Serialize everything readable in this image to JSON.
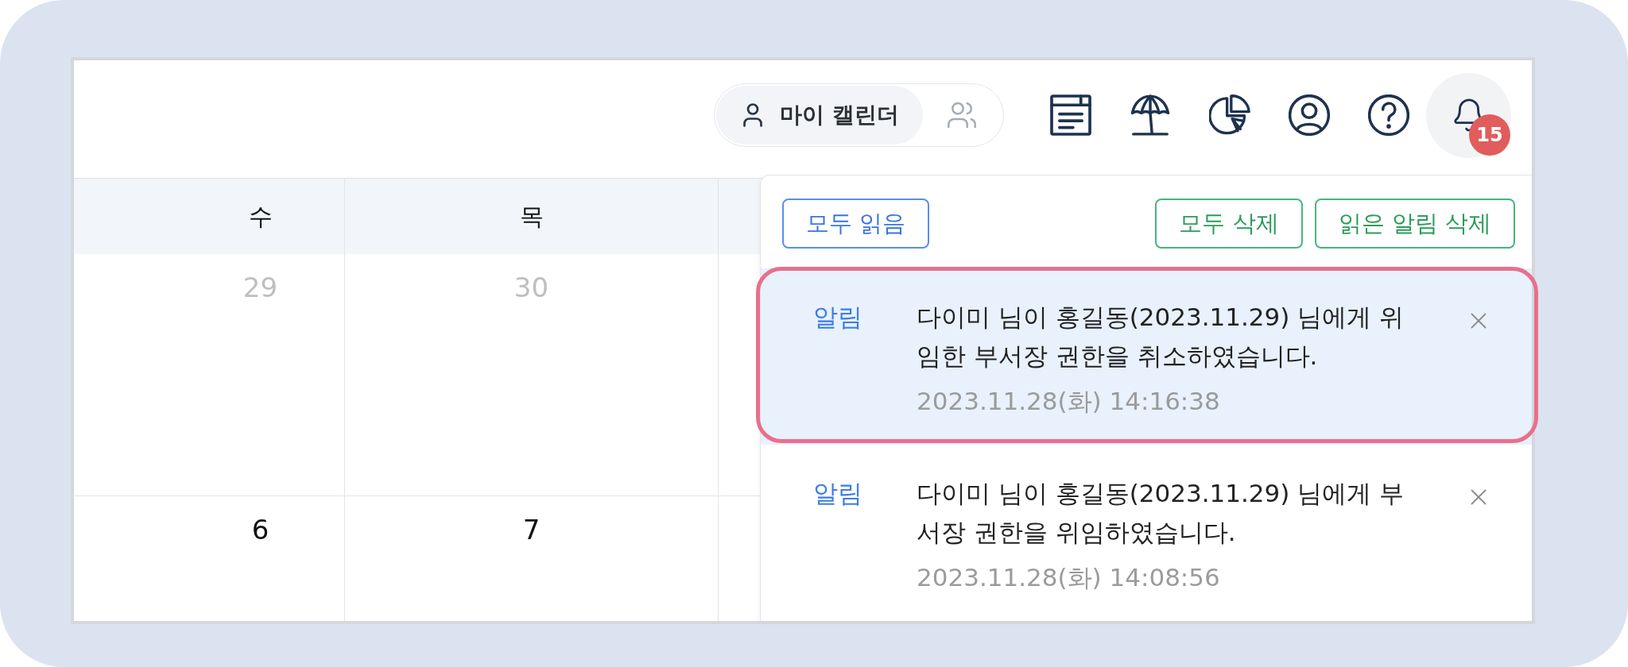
{
  "top_bar": {
    "calendar_switch": [
      {
        "kind": "personal",
        "label": "마이 캘린더",
        "selected": true
      },
      {
        "kind": "shared",
        "selected": false
      }
    ],
    "notifications_button": {
      "badge": "15",
      "open": true
    }
  },
  "calendar": {
    "weekdays": [
      "수",
      "목"
    ],
    "weeks": [
      [
        {
          "day": "29",
          "outside_month": true
        },
        {
          "day": "30",
          "outside_month": true
        }
      ],
      [
        {
          "day": "6",
          "outside_month": false
        },
        {
          "day": "7",
          "outside_month": false
        }
      ]
    ]
  },
  "notification_panel": {
    "actions": [
      {
        "kind": "read",
        "label": "모두 읽음"
      },
      {
        "kind": "delete",
        "label": "모두 삭제"
      },
      {
        "kind": "delete",
        "label": "읽은 알림 삭제"
      }
    ],
    "items": [
      {
        "category": "알림",
        "message": "다이미 님이 홍길동(2023.11.29) 님에게 위임한 부서장 권한을 취소하였습니다.",
        "time": "2023.11.28(화) 14:16:38",
        "highlighted": true
      },
      {
        "category": "알림",
        "message": "다이미 님이 홍길동(2023.11.29) 님에게 부서장 권한을 위임하였습니다.",
        "time": "2023.11.28(화) 14:08:56",
        "highlighted": false
      }
    ]
  }
}
